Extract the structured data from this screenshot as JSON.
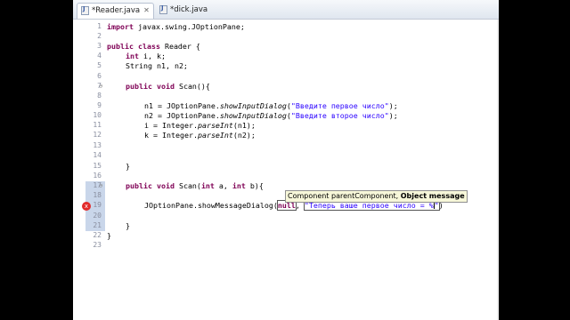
{
  "tabs": [
    {
      "label": "*Reader.java",
      "active": true,
      "close": "✕"
    },
    {
      "label": "*dick.java",
      "active": false
    }
  ],
  "line_numbers": [
    "1",
    "2",
    "3",
    "4",
    "5",
    "6",
    "7",
    "8",
    "9",
    "10",
    "11",
    "12",
    "13",
    "14",
    "15",
    "16",
    "17",
    "18",
    "19",
    "20",
    "21",
    "22",
    "23"
  ],
  "code": {
    "l1": "import javax.swing.JOptionPane;",
    "l3": "public class Reader {",
    "l4": "int i, k;",
    "l5": "String n1, n2;",
    "l7": "public void Scan(){",
    "l9": "n1 = JOptionPane.showInputDialog(\"Введите первое число\");",
    "l10": "n2 = JOptionPane.showInputDialog(\"Введите второе число\");",
    "l11": "i = Integer.parseInt(n1);",
    "l12": "k = Integer.parseInt(n2);",
    "l15": "}",
    "l17": "public void Scan(int a, int b){",
    "l19": "JOptionPane.showMessageDialog(null, \"Теперь ваше первое число = %\")",
    "l21": "}",
    "l22": "}"
  },
  "hint": {
    "regular": "Component parentComponent, ",
    "bold": "Object message"
  },
  "error_marker": "x",
  "colors": {
    "keyword": "#7f0055",
    "string": "#2a00ff",
    "error": "#e22b2b"
  }
}
